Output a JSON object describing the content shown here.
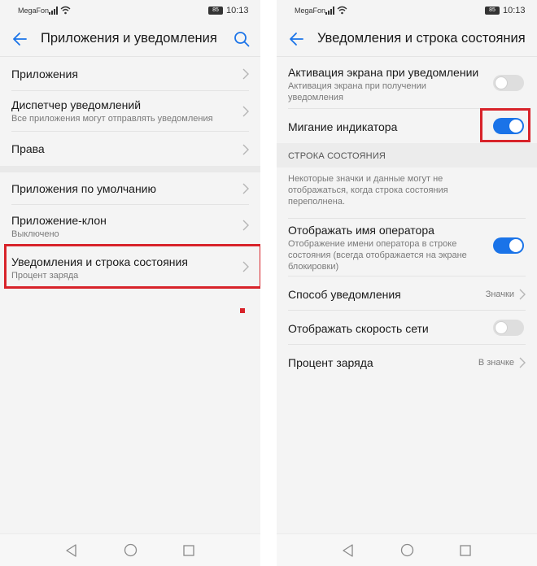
{
  "status_bar": {
    "carrier": "MegaFon",
    "battery": "85",
    "time": "10:13"
  },
  "left": {
    "header_title": "Приложения и уведомления",
    "items": [
      {
        "title": "Приложения"
      },
      {
        "title": "Диспетчер уведомлений",
        "subtitle": "Все приложения могут отправлять уведомления"
      },
      {
        "title": "Права"
      },
      {
        "title": "Приложения по умолчанию"
      },
      {
        "title": "Приложение-клон",
        "subtitle": "Выключено"
      },
      {
        "title": "Уведомления и строка состояния",
        "subtitle": "Процент заряда"
      }
    ]
  },
  "right": {
    "header_title": "Уведомления и строка состояния",
    "screen_wake": {
      "title": "Активация экрана при уведомлении",
      "subtitle": "Активация экрана при получении уведомления",
      "enabled": false
    },
    "indicator_blink": {
      "title": "Мигание индикатора",
      "enabled": true
    },
    "status_bar_section": "СТРОКА СОСТОЯНИЯ",
    "status_bar_note": "Некоторые значки и данные могут не отображаться, когда строка состояния переполнена.",
    "show_operator": {
      "title": "Отображать имя оператора",
      "subtitle": "Отображение имени оператора в строке состояния (всегда отображается на экране блокировки)",
      "enabled": true
    },
    "notification_method": {
      "title": "Способ уведомления",
      "value": "Значки"
    },
    "show_speed": {
      "title": "Отображать скорость сети",
      "enabled": false
    },
    "battery_percent": {
      "title": "Процент заряда",
      "value": "В значке"
    }
  },
  "colors": {
    "accent": "#1a73e8",
    "highlight": "#d8232a",
    "background": "#f4f4f4"
  },
  "icons": [
    "back-arrow-icon",
    "search-icon",
    "chevron-right-icon",
    "signal-icon",
    "wifi-icon",
    "battery-icon",
    "nav-back-icon",
    "nav-home-icon",
    "nav-recent-icon"
  ]
}
